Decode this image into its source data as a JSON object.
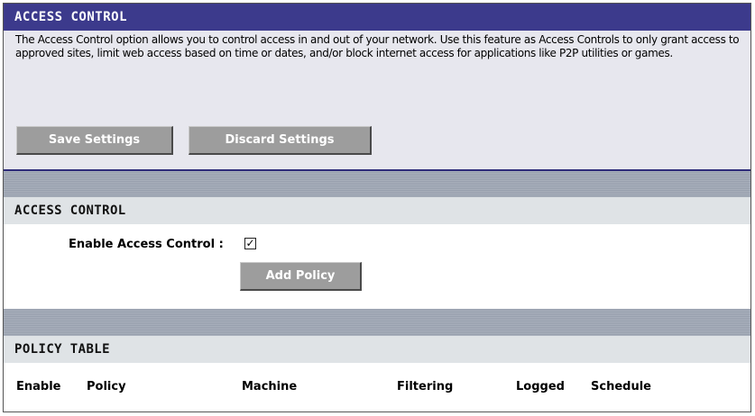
{
  "header": {
    "title": "ACCESS CONTROL"
  },
  "intro": {
    "description": "The Access Control option allows you to control access in and out of your network. Use this feature as Access Controls to only grant access to approved sites, limit web access based on time or dates, and/or block internet access for applications like P2P utilities or games.",
    "save_label": "Save Settings",
    "discard_label": "Discard Settings"
  },
  "access_section": {
    "title": "ACCESS CONTROL",
    "enable_label": "Enable Access Control :",
    "enable_checked": true,
    "checkmark": "✓",
    "add_policy_label": "Add Policy"
  },
  "policy_section": {
    "title": "POLICY TABLE",
    "columns": [
      "Enable",
      "Policy",
      "Machine",
      "Filtering",
      "Logged",
      "Schedule"
    ]
  },
  "colors": {
    "header_bg": "#3c3a8c",
    "panel_bg": "#e7e7ee",
    "button_bg": "#9d9d9d",
    "section_header_bg": "#dfe3e6"
  }
}
